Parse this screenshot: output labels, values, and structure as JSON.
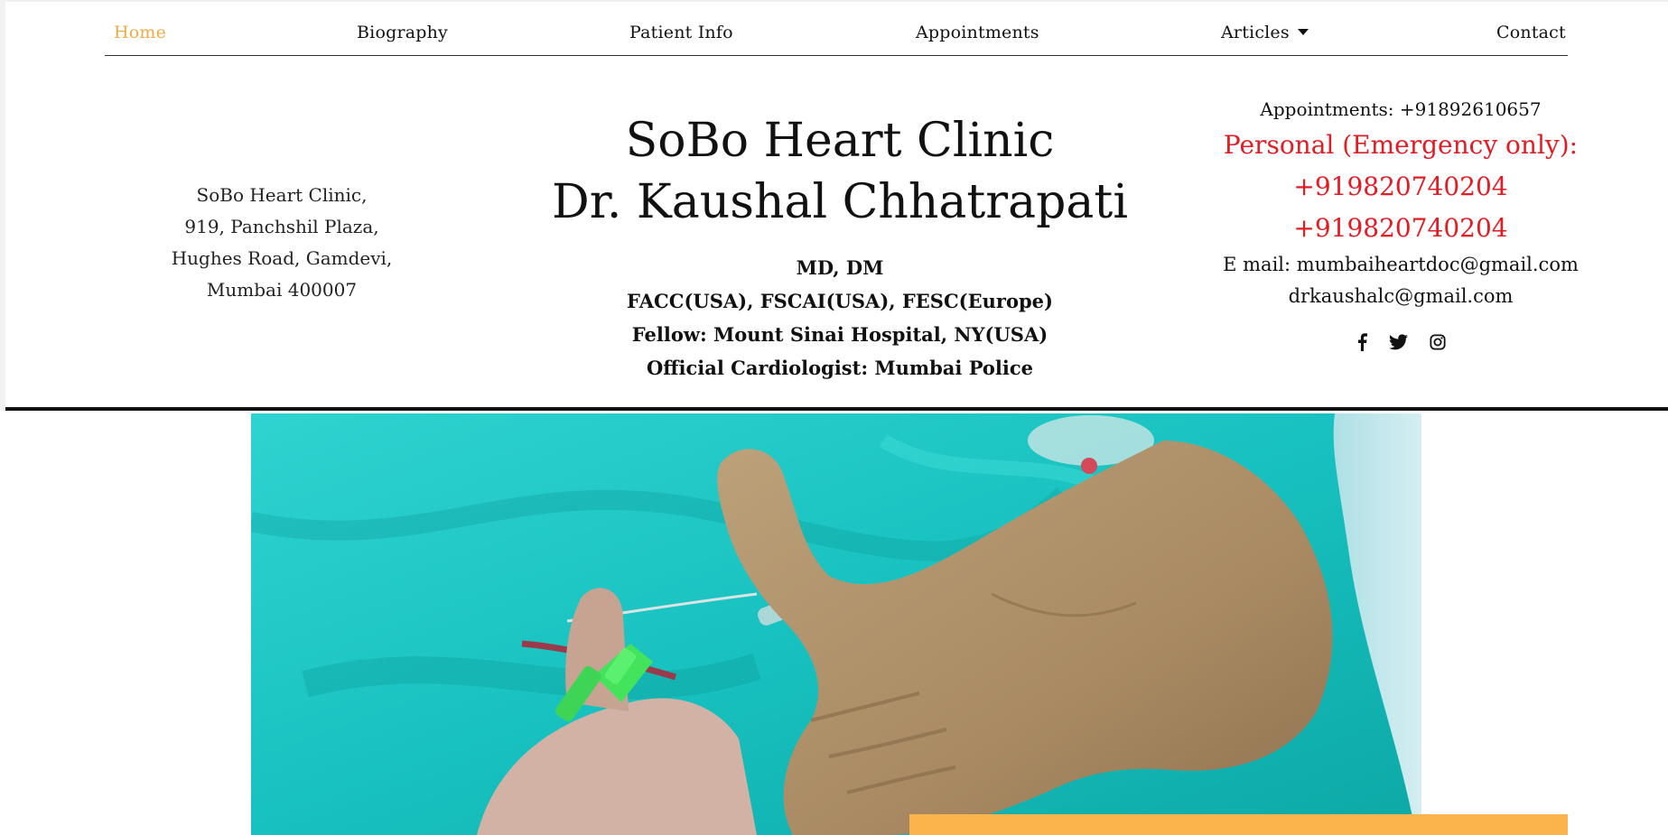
{
  "nav": {
    "items": [
      {
        "label": "Home",
        "active": true
      },
      {
        "label": "Biography",
        "active": false
      },
      {
        "label": "Patient Info",
        "active": false
      },
      {
        "label": "Appointments",
        "active": false
      },
      {
        "label": "Articles",
        "active": false,
        "dropdown": true
      },
      {
        "label": "Contact",
        "active": false
      }
    ],
    "active_color": "#f2a946"
  },
  "address": {
    "lines": [
      "SoBo Heart Clinic,",
      "919, Panchshil Plaza,",
      "Hughes Road, Gamdevi,",
      "Mumbai 400007"
    ]
  },
  "title": {
    "clinic": "SoBo Heart Clinic",
    "doctor": "Dr. Kaushal Chhatrapati"
  },
  "qualifications": [
    "MD, DM",
    "FACC(USA), FSCAI(USA), FESC(Europe)",
    "Fellow: Mount Sinai Hospital, NY(USA)",
    "Official Cardiologist: Mumbai Police"
  ],
  "contact": {
    "appointments": "Appointments: +91892610657",
    "emergency_label": "Personal (Emergency only):",
    "emergency_phones": [
      "+919820740204",
      "+919820740204"
    ],
    "email_1": "E mail: mumbaiheartdoc@gmail.com",
    "email_2": "drkaushalc@gmail.com",
    "emergency_color": "#e31b23"
  },
  "social": {
    "icons": [
      "facebook-icon",
      "twitter-icon",
      "instagram-icon"
    ]
  },
  "hero": {
    "accent_color": "#fbb34b",
    "background_color": "#1cc6c4"
  }
}
